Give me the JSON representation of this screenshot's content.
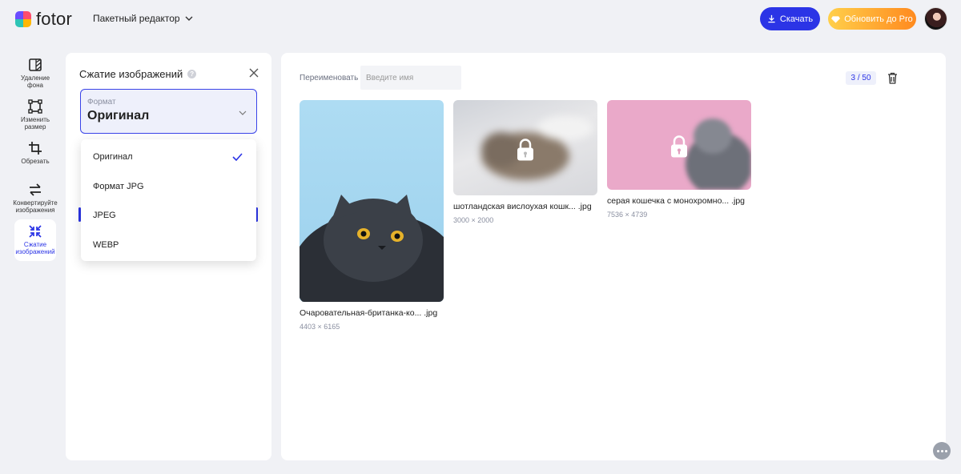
{
  "app": {
    "logo_text": "fotor",
    "mode_label": "Пакетный редактор"
  },
  "header": {
    "download_label": "Скачать",
    "pro_label": "Обновить до Pro"
  },
  "tools": [
    {
      "label": "Удаление фона",
      "icon": "background-remove-icon"
    },
    {
      "label": "Изменить размер",
      "icon": "resize-icon"
    },
    {
      "label": "Обрезать",
      "icon": "crop-icon"
    },
    {
      "label": "Конвертируйте изображения",
      "icon": "convert-icon"
    },
    {
      "label": "Сжатие изображений",
      "icon": "compress-icon",
      "active": true
    }
  ],
  "panel": {
    "title": "Сжатие изображений",
    "format_label": "Формат",
    "format_value": "Оригинал",
    "options": [
      "Оригинал",
      "Формат JPG",
      "JPEG",
      "WEBP"
    ],
    "selected_option": "Оригинал"
  },
  "main": {
    "rename_label": "Переименовать",
    "rename_placeholder": "Введите имя",
    "counter": "3 / 50",
    "images": [
      {
        "name": "Очаровательная-британка-ко... .jpg",
        "size": "4403 × 6165",
        "locked": false
      },
      {
        "name": "шотландская вислоухая кошк... .jpg",
        "size": "3000 × 2000",
        "locked": true
      },
      {
        "name": "серая кошечка с монохромно... .jpg",
        "size": "7536 × 4739",
        "locked": true
      }
    ]
  },
  "colors": {
    "accent": "#2b34e6",
    "pro_start": "#ffcf4a",
    "pro_end": "#ff8a1f",
    "background": "#f0f1f5"
  }
}
